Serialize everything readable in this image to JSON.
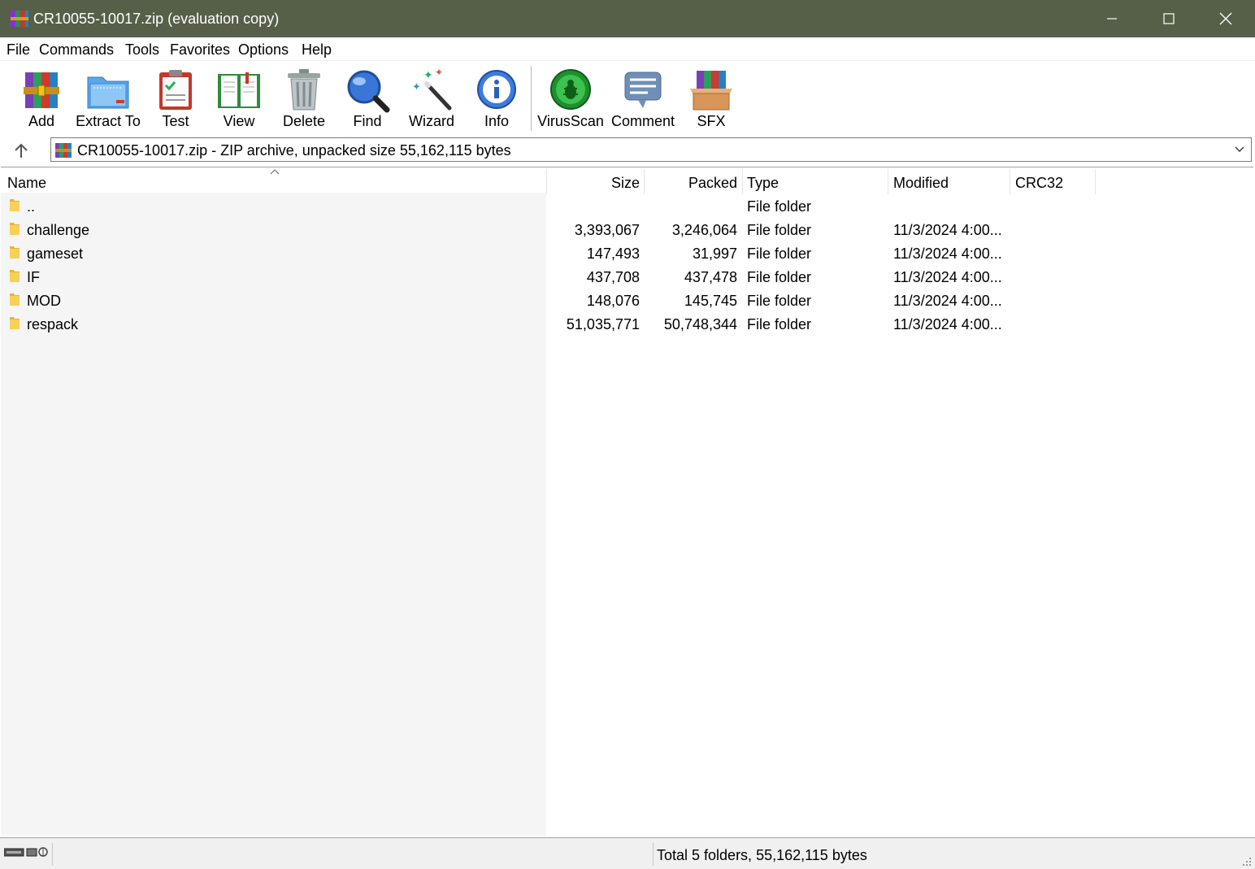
{
  "window": {
    "title": "CR10055-10017.zip (evaluation copy)",
    "title_bar_color": "#566049"
  },
  "menu": [
    "File",
    "Commands",
    "Tools",
    "Favorites",
    "Options",
    "Help"
  ],
  "toolbar": {
    "buttons": [
      {
        "label": "Add",
        "icon": "archive-books-icon"
      },
      {
        "label": "Extract To",
        "icon": "folder-extract-icon"
      },
      {
        "label": "Test",
        "icon": "clipboard-check-icon"
      },
      {
        "label": "View",
        "icon": "open-book-icon"
      },
      {
        "label": "Delete",
        "icon": "trash-can-icon"
      },
      {
        "label": "Find",
        "icon": "magnifier-icon"
      },
      {
        "label": "Wizard",
        "icon": "magic-wand-icon"
      },
      {
        "label": "Info",
        "icon": "info-icon"
      },
      {
        "label": "VirusScan",
        "icon": "bug-scan-icon"
      },
      {
        "label": "Comment",
        "icon": "speech-bubble-icon"
      },
      {
        "label": "SFX",
        "icon": "self-extract-box-icon"
      }
    ]
  },
  "address": {
    "text": "CR10055-10017.zip - ZIP archive, unpacked size 55,162,115 bytes"
  },
  "table": {
    "columns": [
      "Name",
      "Size",
      "Packed",
      "Type",
      "Modified",
      "CRC32"
    ],
    "rows": [
      {
        "name": "..",
        "size": "",
        "packed": "",
        "type": "File folder",
        "modified": "",
        "crc": ""
      },
      {
        "name": "challenge",
        "size": "3,393,067",
        "packed": "3,246,064",
        "type": "File folder",
        "modified": "11/3/2024 4:00...",
        "crc": ""
      },
      {
        "name": "gameset",
        "size": "147,493",
        "packed": "31,997",
        "type": "File folder",
        "modified": "11/3/2024 4:00...",
        "crc": ""
      },
      {
        "name": "IF",
        "size": "437,708",
        "packed": "437,478",
        "type": "File folder",
        "modified": "11/3/2024 4:00...",
        "crc": ""
      },
      {
        "name": "MOD",
        "size": "148,076",
        "packed": "145,745",
        "type": "File folder",
        "modified": "11/3/2024 4:00...",
        "crc": ""
      },
      {
        "name": "respack",
        "size": "51,035,771",
        "packed": "50,748,344",
        "type": "File folder",
        "modified": "11/3/2024 4:00...",
        "crc": ""
      }
    ]
  },
  "status": {
    "text": "Total 5 folders, 55,162,115 bytes"
  }
}
